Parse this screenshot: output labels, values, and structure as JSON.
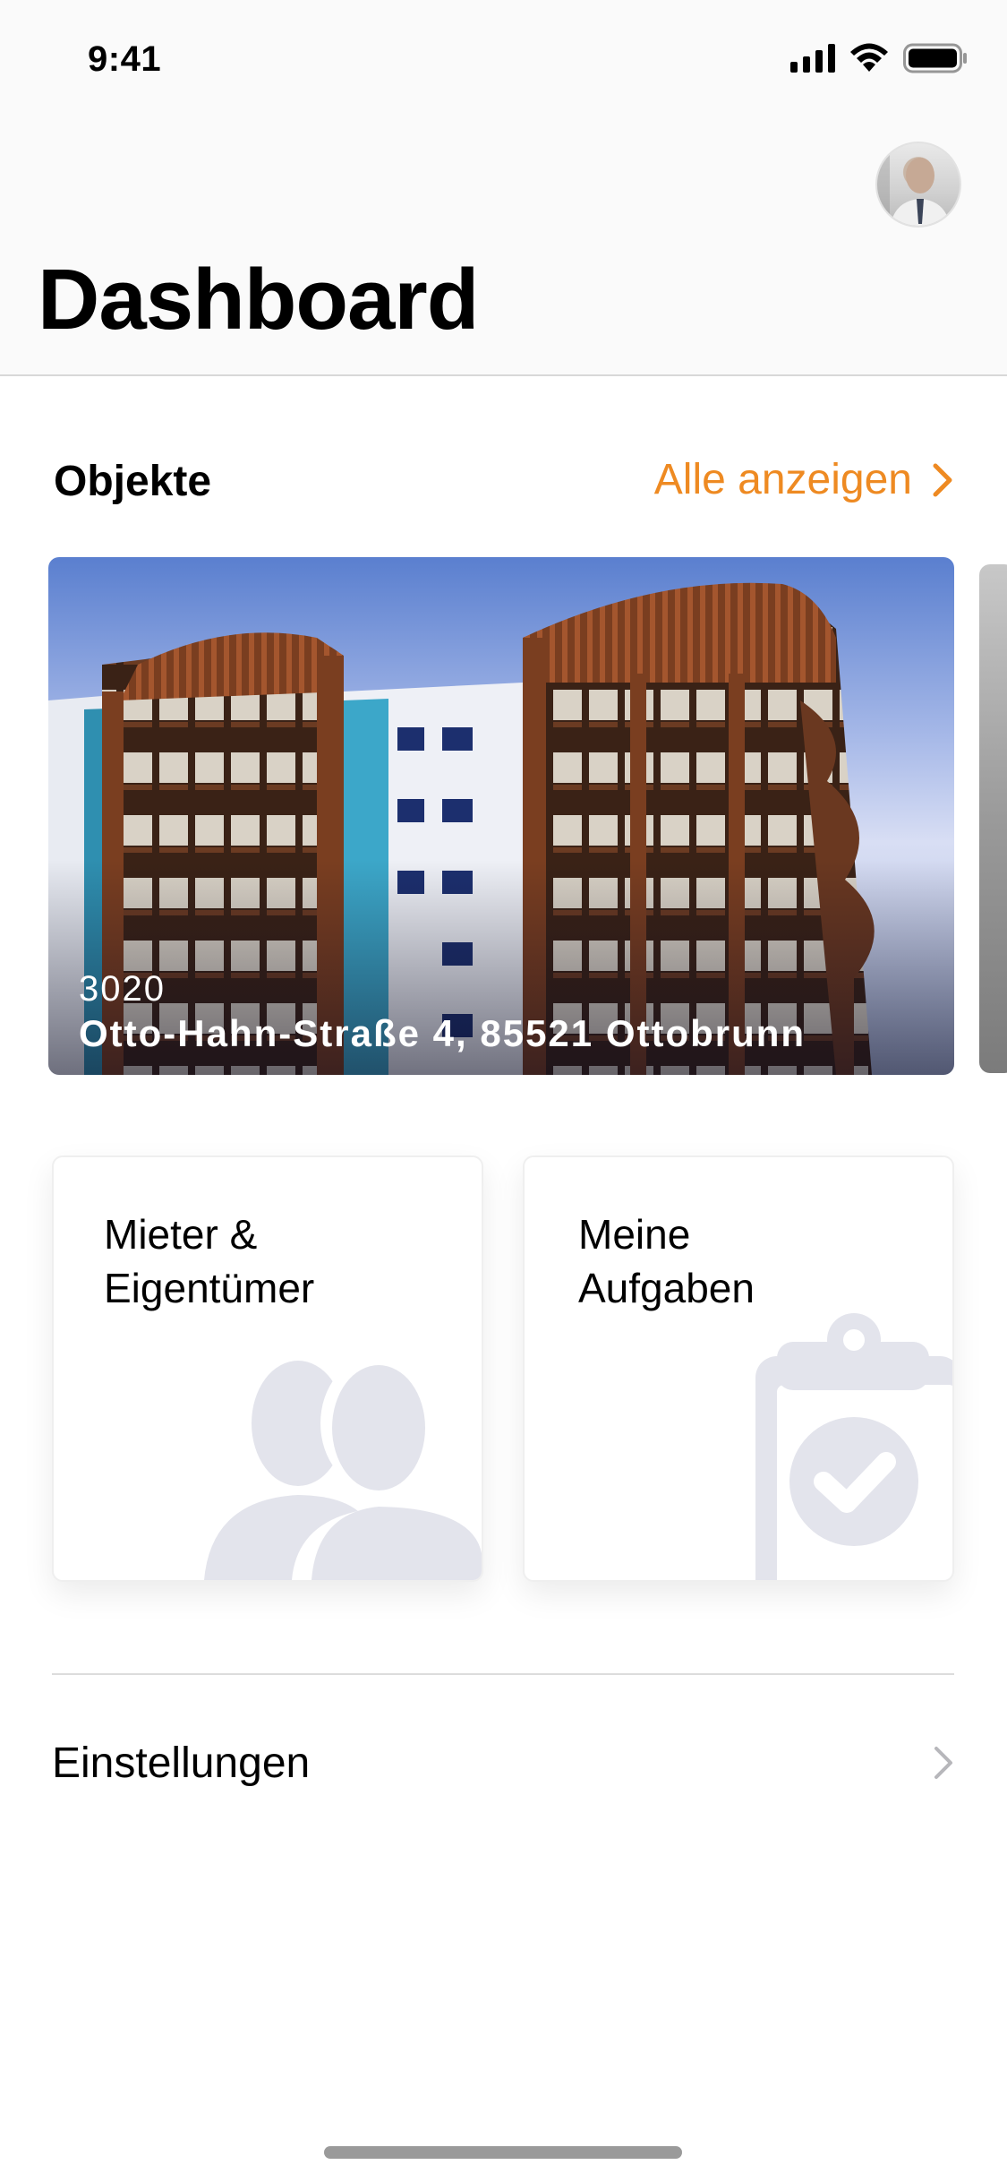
{
  "status_bar": {
    "time": "9:41",
    "icons": [
      "signal-icon",
      "wifi-icon",
      "battery-icon"
    ]
  },
  "header": {
    "title": "Dashboard",
    "avatar_icon": "user-avatar"
  },
  "objects_section": {
    "title": "Objekte",
    "show_all_label": "Alle anzeigen",
    "accent_color": "#EE8A22",
    "properties": [
      {
        "number": "3020",
        "address": "Otto-Hahn-Straße 4, 85521 Ottobrunn"
      }
    ]
  },
  "tiles": [
    {
      "label_line1": "Mieter &",
      "label_line2": "Eigentümer",
      "icon": "people-icon"
    },
    {
      "label_line1": "Meine",
      "label_line2": "Aufgaben",
      "icon": "clipboard-check-icon"
    }
  ],
  "settings": {
    "label": "Einstellungen",
    "icon": "chevron-right-icon"
  }
}
